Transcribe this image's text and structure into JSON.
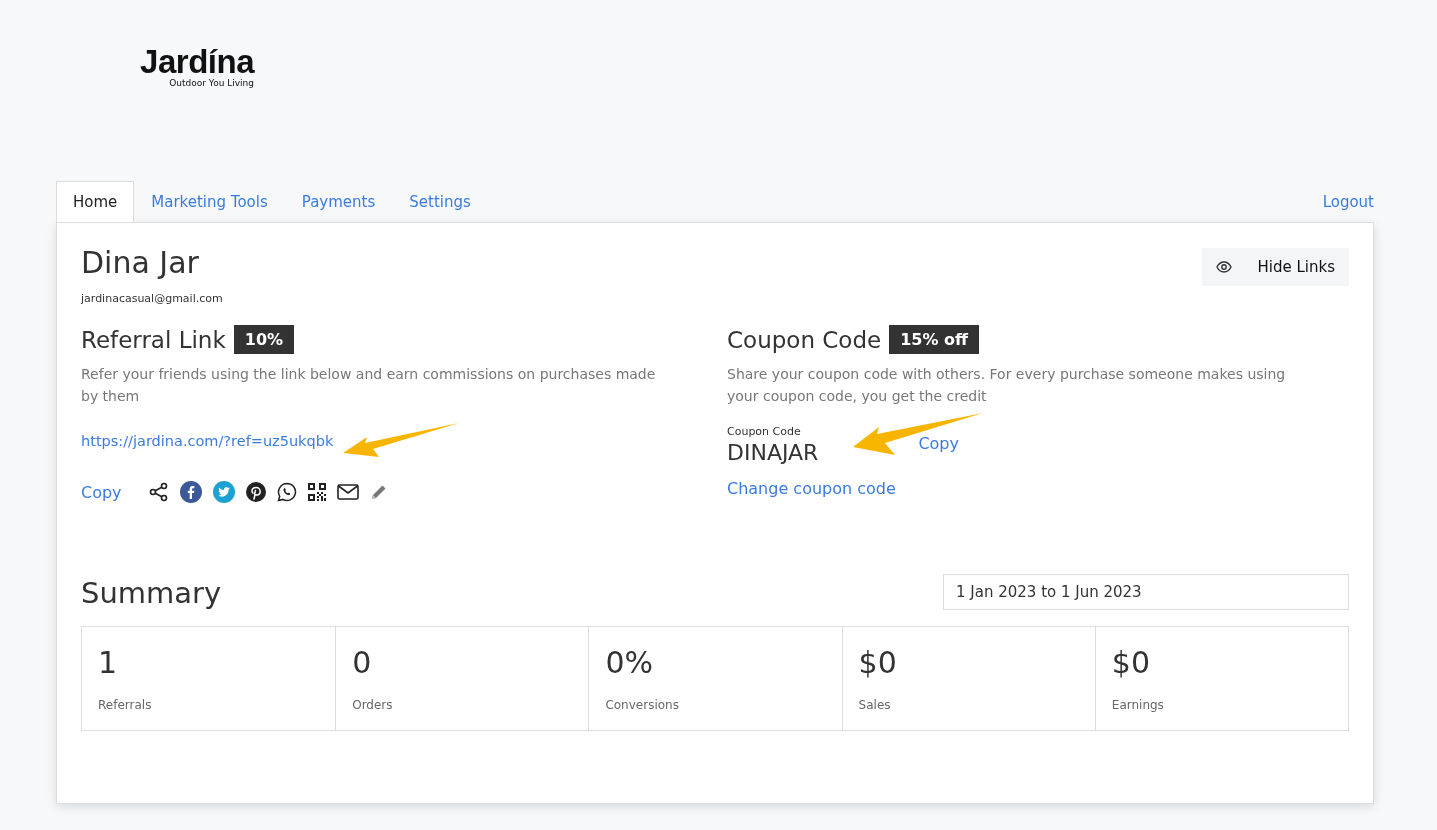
{
  "logo": {
    "name": "Jardína",
    "tagline": "Outdoor You Living"
  },
  "tabs": [
    {
      "label": "Home",
      "selected": true
    },
    {
      "label": "Marketing Tools",
      "selected": false
    },
    {
      "label": "Payments",
      "selected": false
    },
    {
      "label": "Settings",
      "selected": false
    }
  ],
  "logout": "Logout",
  "profile": {
    "name": "Dina Jar",
    "email": "jardinacasual@gmail.com"
  },
  "hide_links": "Hide Links",
  "referral": {
    "title": "Referral Link",
    "badge": "10%",
    "description": "Refer your friends using the link below and earn commissions on purchases made by them",
    "link": "https://jardina.com/?ref=uz5ukqbk",
    "copy": "Copy"
  },
  "coupon": {
    "title": "Coupon Code",
    "badge": "15% off",
    "description": "Share your coupon code with others. For every purchase someone makes using your coupon code, you get the credit",
    "field_label": "Coupon Code",
    "code": "DINAJAR",
    "copy": "Copy",
    "change": "Change coupon code"
  },
  "summary": {
    "title": "Summary",
    "date_range": "1 Jan 2023 to 1 Jun 2023",
    "stats": [
      {
        "value": "1",
        "label": "Referrals"
      },
      {
        "value": "0",
        "label": "Orders"
      },
      {
        "value": "0%",
        "label": "Conversions"
      },
      {
        "value": "$0",
        "label": "Sales"
      },
      {
        "value": "$0",
        "label": "Earnings"
      }
    ]
  }
}
